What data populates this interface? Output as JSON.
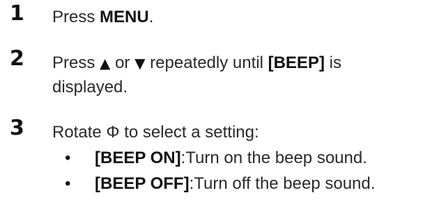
{
  "steps": [
    {
      "number": "1",
      "pre": "Press ",
      "key": "MENU",
      "post": "."
    },
    {
      "number": "2",
      "pre": "Press ",
      "up_icon": "▲",
      "mid": " or ",
      "down_icon": "▼",
      "mid2": " repeatedly until ",
      "key": "[BEEP]",
      "post": " is",
      "line2": "displayed."
    },
    {
      "number": "3",
      "pre": "Rotate ",
      "dial_icon": "Φ",
      "post": " to select a setting:",
      "options": [
        {
          "bullet": "•",
          "label": "[BEEP ON]",
          "desc": ":Turn on the beep sound."
        },
        {
          "bullet": "•",
          "label": "[BEEP OFF]",
          "desc": ":Turn off the beep sound."
        }
      ]
    }
  ],
  "icons": {
    "up": "up-triangle-icon",
    "down": "down-triangle-icon",
    "dial": "dial-icon"
  }
}
